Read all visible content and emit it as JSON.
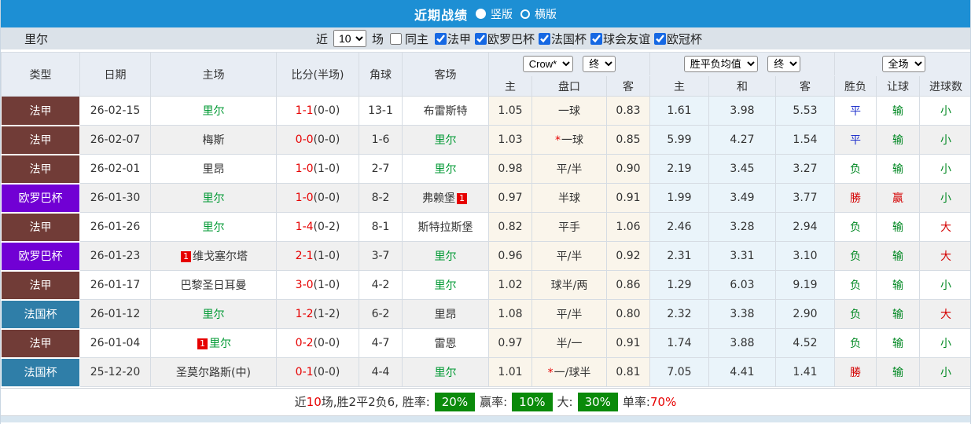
{
  "title_bar": {
    "title": "近期战绩",
    "radio_vertical": "竖版",
    "radio_horizontal": "横版"
  },
  "filter_bar": {
    "team": "里尔",
    "recent_label": "近",
    "recent_count": "10",
    "matches_label": "场",
    "same_home_label": "同主",
    "leagues": [
      "法甲",
      "欧罗巴杯",
      "法国杯",
      "球会友谊",
      "欧冠杯"
    ]
  },
  "colors": {
    "accent_blue": "#1d8fd4",
    "league": {
      "ligue1": "#713c37",
      "europa": "#7100d4",
      "coupe": "#2f7ea8"
    },
    "self_team_green": "#009933",
    "score_red": "#e60000",
    "summary_badge_green": "#0a8a0a",
    "crow_columns_bg": "#faf5eb",
    "avg_columns_bg": "#eaf4fa"
  },
  "table": {
    "selects": {
      "company": "Crow*",
      "company_time": "终",
      "avg": "胜平负均值",
      "avg_time": "终",
      "scope": "全场"
    },
    "headers": {
      "type": "类型",
      "date": "日期",
      "home": "主场",
      "score": "比分(半场)",
      "corner": "角球",
      "away": "客场",
      "odds_home": "主",
      "handicap": "盘口",
      "odds_away": "客",
      "avg_home": "主",
      "avg_draw": "和",
      "avg_away": "客",
      "result": "胜负",
      "handicap_result": "让球",
      "goals": "进球数"
    },
    "rows": [
      {
        "type": {
          "label": "法甲",
          "key": "ligue1"
        },
        "date": "26-02-15",
        "home": {
          "name": "里尔",
          "is_self": true
        },
        "score": {
          "full": "1-1",
          "half": "(0-0)"
        },
        "corner": "13-1",
        "away": {
          "name": "布雷斯特",
          "is_self": false
        },
        "crow": {
          "home": "1.05",
          "star": false,
          "handicap": "一球",
          "away": "0.83"
        },
        "avg": {
          "home": "1.61",
          "draw": "3.98",
          "away": "5.53"
        },
        "result": {
          "text": "平",
          "color": "blue"
        },
        "handicap_result": {
          "text": "输",
          "color": "green"
        },
        "goals": {
          "text": "小",
          "color": "green"
        }
      },
      {
        "type": {
          "label": "法甲",
          "key": "ligue1"
        },
        "date": "26-02-07",
        "home": {
          "name": "梅斯",
          "is_self": false
        },
        "score": {
          "full": "0-0",
          "half": "(0-0)"
        },
        "corner": "1-6",
        "away": {
          "name": "里尔",
          "is_self": true
        },
        "crow": {
          "home": "1.03",
          "star": true,
          "handicap": "一球",
          "away": "0.85"
        },
        "avg": {
          "home": "5.99",
          "draw": "4.27",
          "away": "1.54"
        },
        "result": {
          "text": "平",
          "color": "blue"
        },
        "handicap_result": {
          "text": "输",
          "color": "green"
        },
        "goals": {
          "text": "小",
          "color": "green"
        }
      },
      {
        "type": {
          "label": "法甲",
          "key": "ligue1"
        },
        "date": "26-02-01",
        "home": {
          "name": "里昂",
          "is_self": false
        },
        "score": {
          "full": "1-0",
          "half": "(1-0)"
        },
        "corner": "2-7",
        "away": {
          "name": "里尔",
          "is_self": true
        },
        "crow": {
          "home": "0.98",
          "star": false,
          "handicap": "平/半",
          "away": "0.90"
        },
        "avg": {
          "home": "2.19",
          "draw": "3.45",
          "away": "3.27"
        },
        "result": {
          "text": "负",
          "color": "green"
        },
        "handicap_result": {
          "text": "输",
          "color": "green"
        },
        "goals": {
          "text": "小",
          "color": "green"
        }
      },
      {
        "type": {
          "label": "欧罗巴杯",
          "key": "europa"
        },
        "date": "26-01-30",
        "home": {
          "name": "里尔",
          "is_self": true
        },
        "score": {
          "full": "1-0",
          "half": "(0-0)"
        },
        "corner": "8-2",
        "away": {
          "name": "弗赖堡",
          "is_self": false,
          "badge": "1",
          "badge_pos": "after"
        },
        "crow": {
          "home": "0.97",
          "star": false,
          "handicap": "半球",
          "away": "0.91"
        },
        "avg": {
          "home": "1.99",
          "draw": "3.49",
          "away": "3.77"
        },
        "result": {
          "text": "勝",
          "color": "red"
        },
        "handicap_result": {
          "text": "赢",
          "color": "red"
        },
        "goals": {
          "text": "小",
          "color": "green"
        }
      },
      {
        "type": {
          "label": "法甲",
          "key": "ligue1"
        },
        "date": "26-01-26",
        "home": {
          "name": "里尔",
          "is_self": true
        },
        "score": {
          "full": "1-4",
          "half": "(0-2)"
        },
        "corner": "8-1",
        "away": {
          "name": "斯特拉斯堡",
          "is_self": false
        },
        "crow": {
          "home": "0.82",
          "star": false,
          "handicap": "平手",
          "away": "1.06"
        },
        "avg": {
          "home": "2.46",
          "draw": "3.28",
          "away": "2.94"
        },
        "result": {
          "text": "负",
          "color": "green"
        },
        "handicap_result": {
          "text": "输",
          "color": "green"
        },
        "goals": {
          "text": "大",
          "color": "red"
        }
      },
      {
        "type": {
          "label": "欧罗巴杯",
          "key": "europa"
        },
        "date": "26-01-23",
        "home": {
          "name": "维戈塞尔塔",
          "is_self": false,
          "badge": "1",
          "badge_pos": "before"
        },
        "score": {
          "full": "2-1",
          "half": "(1-0)"
        },
        "corner": "3-7",
        "away": {
          "name": "里尔",
          "is_self": true
        },
        "crow": {
          "home": "0.96",
          "star": false,
          "handicap": "平/半",
          "away": "0.92"
        },
        "avg": {
          "home": "2.31",
          "draw": "3.31",
          "away": "3.10"
        },
        "result": {
          "text": "负",
          "color": "green"
        },
        "handicap_result": {
          "text": "输",
          "color": "green"
        },
        "goals": {
          "text": "大",
          "color": "red"
        }
      },
      {
        "type": {
          "label": "法甲",
          "key": "ligue1"
        },
        "date": "26-01-17",
        "home": {
          "name": "巴黎圣日耳曼",
          "is_self": false
        },
        "score": {
          "full": "3-0",
          "half": "(1-0)"
        },
        "corner": "4-2",
        "away": {
          "name": "里尔",
          "is_self": true
        },
        "crow": {
          "home": "1.02",
          "star": false,
          "handicap": "球半/两",
          "away": "0.86"
        },
        "avg": {
          "home": "1.29",
          "draw": "6.03",
          "away": "9.19"
        },
        "result": {
          "text": "负",
          "color": "green"
        },
        "handicap_result": {
          "text": "输",
          "color": "green"
        },
        "goals": {
          "text": "小",
          "color": "green"
        }
      },
      {
        "type": {
          "label": "法国杯",
          "key": "coupe"
        },
        "date": "26-01-12",
        "home": {
          "name": "里尔",
          "is_self": true
        },
        "score": {
          "full": "1-2",
          "half": "(1-2)"
        },
        "corner": "6-2",
        "away": {
          "name": "里昂",
          "is_self": false
        },
        "crow": {
          "home": "1.08",
          "star": false,
          "handicap": "平/半",
          "away": "0.80"
        },
        "avg": {
          "home": "2.32",
          "draw": "3.38",
          "away": "2.90"
        },
        "result": {
          "text": "负",
          "color": "green"
        },
        "handicap_result": {
          "text": "输",
          "color": "green"
        },
        "goals": {
          "text": "大",
          "color": "red"
        }
      },
      {
        "type": {
          "label": "法甲",
          "key": "ligue1"
        },
        "date": "26-01-04",
        "home": {
          "name": "里尔",
          "is_self": true,
          "badge": "1",
          "badge_pos": "before"
        },
        "score": {
          "full": "0-2",
          "half": "(0-0)"
        },
        "corner": "4-7",
        "away": {
          "name": "雷恩",
          "is_self": false
        },
        "crow": {
          "home": "0.97",
          "star": false,
          "handicap": "半/一",
          "away": "0.91"
        },
        "avg": {
          "home": "1.74",
          "draw": "3.88",
          "away": "4.52"
        },
        "result": {
          "text": "负",
          "color": "green"
        },
        "handicap_result": {
          "text": "输",
          "color": "green"
        },
        "goals": {
          "text": "小",
          "color": "green"
        }
      },
      {
        "type": {
          "label": "法国杯",
          "key": "coupe"
        },
        "date": "25-12-20",
        "home": {
          "name": "圣莫尔路斯(中)",
          "is_self": false
        },
        "score": {
          "full": "0-1",
          "half": "(0-0)"
        },
        "corner": "4-4",
        "away": {
          "name": "里尔",
          "is_self": true
        },
        "crow": {
          "home": "1.01",
          "star": true,
          "handicap": "一/球半",
          "away": "0.81"
        },
        "avg": {
          "home": "7.05",
          "draw": "4.41",
          "away": "1.41"
        },
        "result": {
          "text": "勝",
          "color": "red"
        },
        "handicap_result": {
          "text": "输",
          "color": "green"
        },
        "goals": {
          "text": "小",
          "color": "green"
        }
      }
    ]
  },
  "summary": {
    "prefix": "近",
    "count": "10",
    "record": "场,胜2平2负6, 胜率:",
    "win_rate": "20%",
    "label_profit": "赢率:",
    "profit_rate": "10%",
    "label_big": "大:",
    "big_rate": "30%",
    "label_single": "单率:",
    "single_rate": "70%"
  }
}
